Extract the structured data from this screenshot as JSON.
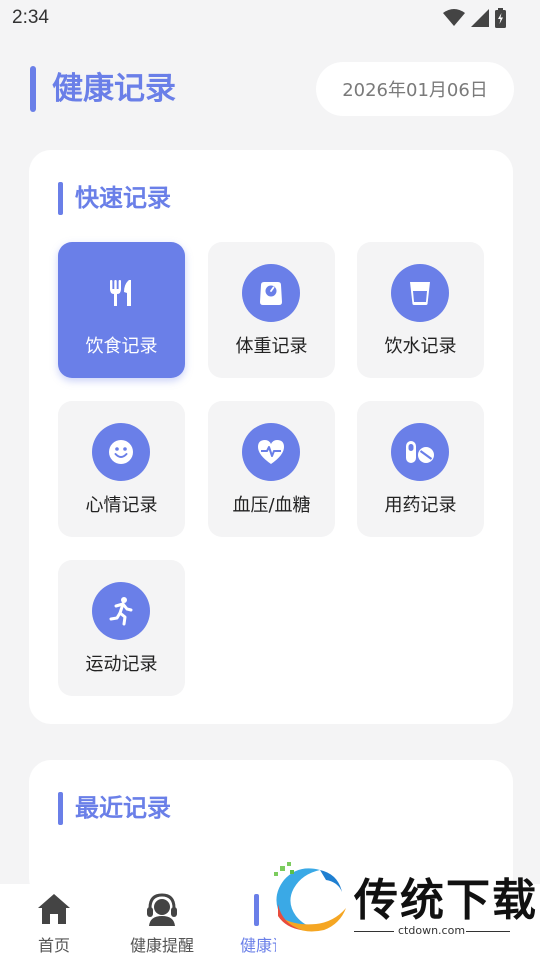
{
  "status_bar": {
    "time": "2:34",
    "icons": [
      "wifi-icon",
      "signal-icon",
      "battery-icon"
    ]
  },
  "header": {
    "title": "健康记录",
    "date": "2026年01月06日"
  },
  "quick_record": {
    "title": "快速记录",
    "tiles": [
      {
        "label": "饮食记录",
        "icon": "fork-knife-icon",
        "active": true
      },
      {
        "label": "体重记录",
        "icon": "scale-icon",
        "active": false
      },
      {
        "label": "饮水记录",
        "icon": "water-cup-icon",
        "active": false
      },
      {
        "label": "心情记录",
        "icon": "smile-icon",
        "active": false
      },
      {
        "label": "血压/血糖",
        "icon": "heart-pulse-icon",
        "active": false
      },
      {
        "label": "用药记录",
        "icon": "pill-icon",
        "active": false
      },
      {
        "label": "运动记录",
        "icon": "running-icon",
        "active": false
      }
    ]
  },
  "recent_record": {
    "title": "最近记录"
  },
  "bottom_nav": {
    "items": [
      {
        "label": "首页",
        "icon": "home-icon"
      },
      {
        "label": "健康提醒",
        "icon": "headset-icon"
      },
      {
        "label": "健康记录",
        "icon": "record-icon",
        "active": true
      }
    ]
  },
  "watermark": {
    "text": "传统下载",
    "url": "ctdown.com"
  },
  "colors": {
    "accent": "#6a7fe8",
    "background": "#f4f4f5",
    "card": "#ffffff",
    "tile": "#f4f4f5"
  }
}
